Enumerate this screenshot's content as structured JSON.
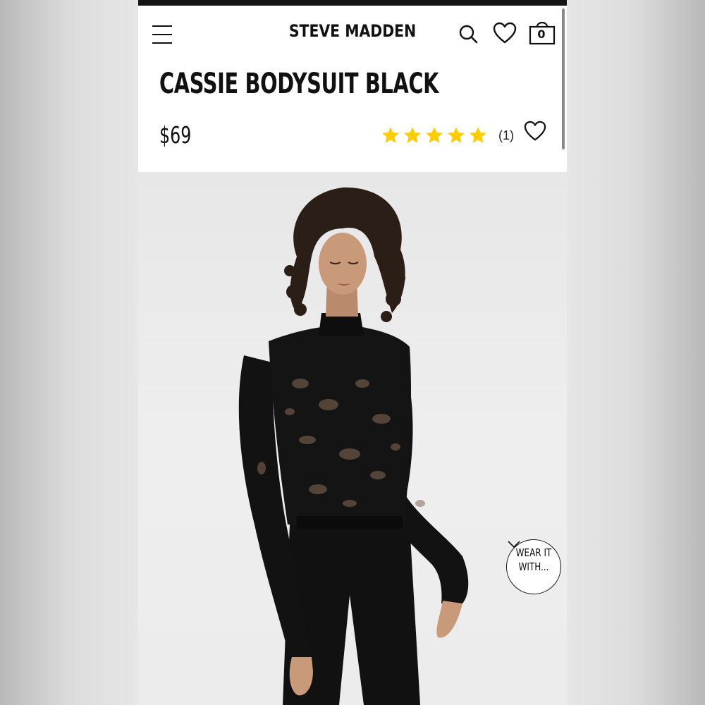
{
  "header": {
    "brand": "STEVE MADDEN",
    "menu_icon": "hamburger-menu-icon",
    "search_icon": "search-icon",
    "wishlist_icon": "heart-icon",
    "bag_icon": "shopping-bag-icon",
    "bag_count": "0"
  },
  "product": {
    "title": "CASSIE BODYSUIT BLACK",
    "price": "$69",
    "rating": 5,
    "rating_max": 5,
    "review_count": "(1)",
    "favorite_icon": "heart-icon"
  },
  "photo": {
    "wear_it_line1": "WEAR IT",
    "wear_it_line2": "WITH...",
    "wear_it_icon": "chevron-down-icon"
  },
  "colors": {
    "star": "#FFCC00",
    "text": "#111111",
    "page_background": "#FFFFFF",
    "backdrop": "#E6E6E6",
    "garment": "#111111",
    "skin": "#C99A7A",
    "hair": "#2A1E17"
  }
}
